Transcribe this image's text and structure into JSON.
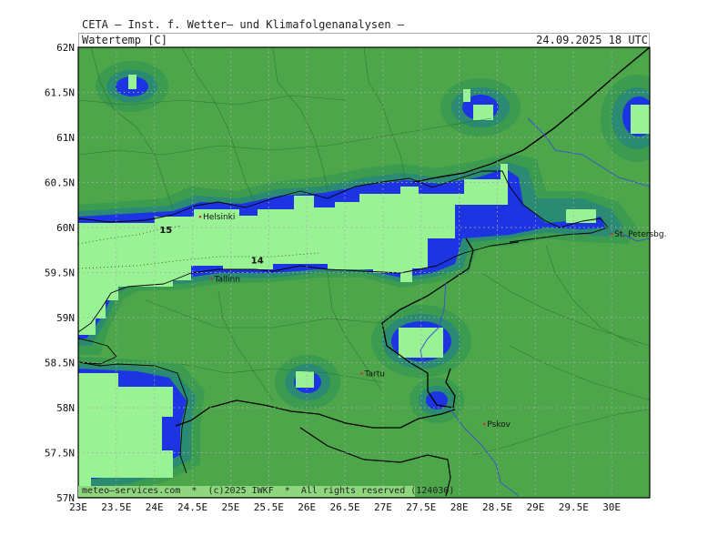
{
  "header": {
    "line1": "CETA — Inst. f. Wetter— und Klimafolgenanalysen —",
    "parameter": "Watertemp [C]",
    "valid": "24.09.2025 18 UTC"
  },
  "axes": {
    "y_labels": [
      "62N",
      "61.5N",
      "61N",
      "60.5N",
      "60N",
      "59.5N",
      "59N",
      "58.5N",
      "58N",
      "57.5N",
      "57N"
    ],
    "x_labels": [
      "23E",
      "23.5E",
      "24E",
      "24.5E",
      "25E",
      "25.5E",
      "26E",
      "26.5E",
      "27E",
      "27.5E",
      "28E",
      "28.5E",
      "29E",
      "29.5E",
      "30E"
    ],
    "lon_range": [
      23,
      30.5
    ],
    "lat_range": [
      57,
      62
    ],
    "grid": "dotted"
  },
  "places": [
    {
      "name": "Helsinki",
      "lon": 24.6,
      "lat": 60.12
    },
    {
      "name": "Tallinn",
      "lon": 24.75,
      "lat": 59.43
    },
    {
      "name": "Tartu",
      "lon": 26.72,
      "lat": 58.38
    },
    {
      "name": "Pskov",
      "lon": 28.33,
      "lat": 57.82
    },
    {
      "name": "St. Petersbg.",
      "lon": 30.0,
      "lat": 59.93
    }
  ],
  "contour_labels": [
    {
      "text": "15",
      "lon": 24.15,
      "lat": 59.94
    },
    {
      "text": "14",
      "lon": 25.35,
      "lat": 59.6
    }
  ],
  "colors": {
    "land": "#4ea64a",
    "water_warm": "#99f294",
    "halo_1": "#3b9b4e",
    "halo_2": "#2a8a72",
    "halo_3": "#1c7ea0",
    "halo_4": "#1d34e2",
    "border": "#000000",
    "river": "#3b55c8"
  },
  "footer": "meteo—services.com  *  (c)2025 IWKF  *  All rights reserved (124030)"
}
